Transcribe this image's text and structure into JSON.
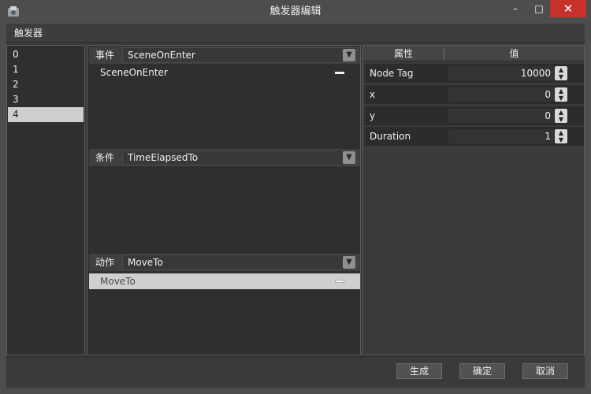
{
  "window": {
    "title": "触发器编辑",
    "min_glyph": "–",
    "max_glyph": "□",
    "close_glyph": "✕"
  },
  "menu": {
    "items": [
      "触发器"
    ]
  },
  "trigger_list": {
    "items": [
      "0",
      "1",
      "2",
      "3",
      "4"
    ],
    "selected_index": 4
  },
  "event_section": {
    "label": "事件",
    "combo_value": "SceneOnEnter",
    "entries": [
      "SceneOnEnter"
    ]
  },
  "condition_section": {
    "label": "条件",
    "combo_value": "TimeElapsedTo",
    "entries": []
  },
  "action_section": {
    "label": "动作",
    "combo_value": "MoveTo",
    "entries": [
      "MoveTo"
    ]
  },
  "properties": {
    "header_name": "属性",
    "header_value": "值",
    "rows": [
      {
        "name": "Node Tag",
        "value": "10000"
      },
      {
        "name": "x",
        "value": "0"
      },
      {
        "name": "y",
        "value": "0"
      },
      {
        "name": "Duration",
        "value": "1"
      }
    ]
  },
  "buttons": {
    "generate": "生成",
    "ok": "确定",
    "cancel": "取消"
  },
  "colors": {
    "selected_bg": "#cfcfcf",
    "close_button": "#c7302b",
    "panel_bg": "#2f2f2f"
  },
  "icons": {
    "app": "app-icon",
    "combo_arrow": "chevron-down-icon",
    "remove": "minus-icon",
    "spin_up": "arrow-up-icon",
    "spin_down": "arrow-down-icon"
  }
}
